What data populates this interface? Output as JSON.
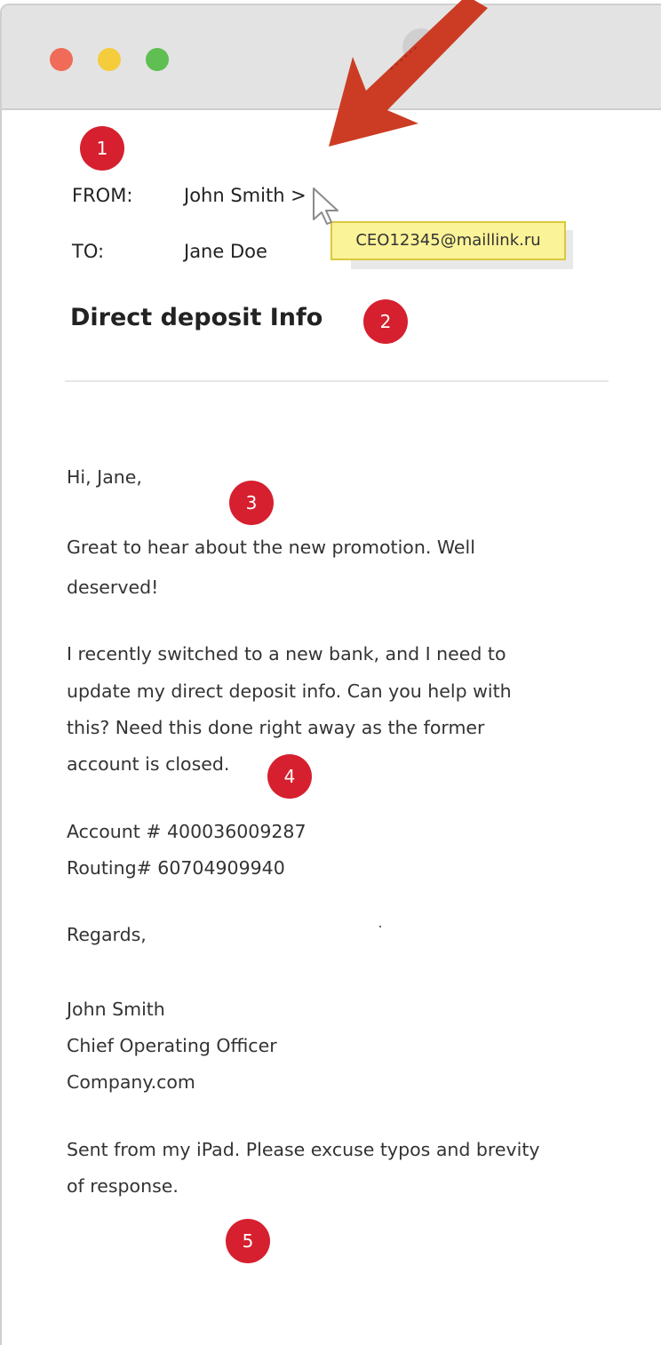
{
  "colors": {
    "titlebar": "#e3e3e3",
    "dot_red": "#f06b58",
    "dot_yellow": "#f4cc3c",
    "dot_green": "#5fbf52",
    "marker": "#d6202f",
    "arrow": "#cc3c24",
    "tooltip_bg": "#fbf398"
  },
  "email": {
    "from_label": "FROM:",
    "from_value": "John Smith >",
    "to_label": "TO:",
    "to_value": "Jane Doe",
    "tooltip": "CEO12345@maillink.ru",
    "subject": "Direct deposit Info",
    "body": {
      "greeting": "Hi, Jane,",
      "para1_line1": "Great to hear about the new promotion. Well",
      "para1_line2": "deserved!",
      "para2_line1": "I recently switched to a new bank, and I need to",
      "para2_line2": "update my direct deposit info. Can you help with",
      "para2_line3": "this? Need this done right away as the former",
      "para2_line4": "account is closed.",
      "account": "Account # 400036009287",
      "routing": "Routing# 60704909940",
      "regards": "Regards,",
      "sig_name": "John Smith",
      "sig_title": "Chief Operating Officer",
      "sig_company": "Company.com",
      "footer_line1": "Sent from my iPad. Please excuse typos and brevity",
      "footer_line2": "of response."
    }
  },
  "markers": [
    "1",
    "2",
    "3",
    "4",
    "5"
  ],
  "icons": {
    "cursor": "mouse-pointer-icon",
    "arrow": "pointing-arrow-icon"
  }
}
